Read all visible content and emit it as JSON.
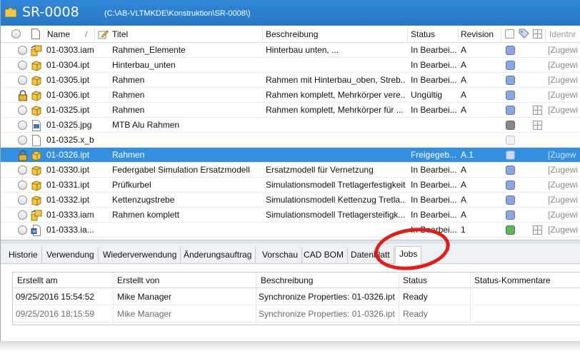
{
  "window": {
    "title": "SR-0008",
    "path": "(C:\\AB-VLTMKDE\\Konstruktion\\SR-0008\\)"
  },
  "columns": {
    "name": "Name",
    "titel": "Titel",
    "beschreibung": "Beschreibung",
    "status": "Status",
    "revision": "Revision",
    "extra": "Identnr"
  },
  "rows": [
    {
      "name": "01-0303.iam",
      "titel": "Rahmen_Elemente",
      "beschreibung": "Hinterbau unten, ...",
      "status": "In Bearbei...",
      "revision": "A",
      "extra": "[Zugewi",
      "icon": "assembly-icon",
      "state": "blue",
      "bom": false,
      "locked": false,
      "selected": false
    },
    {
      "name": "01-0304.ipt",
      "titel": "Hinterbau_unten",
      "beschreibung": "",
      "status": "In Bearbei...",
      "revision": "A",
      "extra": "[Zugewi",
      "icon": "part-icon",
      "state": "blue",
      "bom": false,
      "locked": false,
      "selected": false
    },
    {
      "name": "01-0305.ipt",
      "titel": "Rahmen",
      "beschreibung": "Rahmen mit Hinterbau_oben, Streb...",
      "status": "In Bearbei...",
      "revision": "A",
      "extra": "[Zugewi",
      "icon": "part-icon",
      "state": "blue",
      "bom": false,
      "locked": false,
      "selected": false
    },
    {
      "name": "01-0306.ipt",
      "titel": "Rahmen",
      "beschreibung": "Rahmen komplett, Mehrkörper vere...",
      "status": "Ungültig",
      "revision": "A",
      "extra": "[Zugewi",
      "icon": "part-icon",
      "state": "blue",
      "bom": false,
      "locked": true,
      "selected": false
    },
    {
      "name": "01-0325.ipt",
      "titel": "Rahmen",
      "beschreibung": "Rahmen komplett, Mehrkörper für ...",
      "status": "In Bearbei...",
      "revision": "A",
      "extra": "[Zugewi",
      "icon": "part-icon",
      "state": "blue",
      "bom": true,
      "locked": false,
      "selected": false
    },
    {
      "name": "01-0325.jpg",
      "titel": "MTB Alu Rahmen",
      "beschreibung": "",
      "status": "",
      "revision": "",
      "extra": "",
      "icon": "image-icon",
      "state": "gray",
      "bom": true,
      "locked": false,
      "selected": false
    },
    {
      "name": "01-0325.x_b",
      "titel": "",
      "beschreibung": "",
      "status": "",
      "revision": "",
      "extra": "",
      "icon": "document-icon",
      "state": "light",
      "bom": false,
      "locked": false,
      "selected": false
    },
    {
      "name": "01-0326.ipt",
      "titel": "Rahmen",
      "beschreibung": "",
      "status": "Freigegeb...",
      "revision": "A.1",
      "extra": "[Zugew",
      "icon": "part-icon",
      "state": "selected",
      "bom": false,
      "locked": true,
      "selected": true
    },
    {
      "name": "01-0330.ipt",
      "titel": "Federgabel Simulation Ersatzmodell",
      "beschreibung": "Ersatzmodell für Vernetzung",
      "status": "In Bearbei...",
      "revision": "A",
      "extra": "[Zugewi",
      "icon": "part-icon",
      "state": "blue",
      "bom": false,
      "locked": false,
      "selected": false
    },
    {
      "name": "01-0331.ipt",
      "titel": "Prüfkurbel",
      "beschreibung": "Simulationsmodell Tretlagerfestigkeit",
      "status": "In Bearbei...",
      "revision": "A",
      "extra": "[Zugewi",
      "icon": "part-icon",
      "state": "blue",
      "bom": false,
      "locked": false,
      "selected": false
    },
    {
      "name": "01-0332.ipt",
      "titel": "Kettenzugstrebe",
      "beschreibung": "Simulationsmodell Kettenzug Tretla...",
      "status": "In Bearbei...",
      "revision": "A",
      "extra": "[Zugewi",
      "icon": "part-icon",
      "state": "blue",
      "bom": false,
      "locked": false,
      "selected": false
    },
    {
      "name": "01-0333.iam",
      "titel": "Rahmen komplett",
      "beschreibung": "Simulationsmodell Tretlagersteifigk...",
      "status": "In Bearbei...",
      "revision": "A",
      "extra": "[Zugewi",
      "icon": "assembly-icon",
      "state": "blue",
      "bom": false,
      "locked": false,
      "selected": false
    },
    {
      "name": "01-0333.ia...",
      "titel": "",
      "beschreibung": "",
      "status": "In Bearbei...",
      "revision": "1",
      "extra": "[Zugewi",
      "icon": "word-doc-icon",
      "state": "green",
      "bom": true,
      "locked": false,
      "selected": false
    }
  ],
  "tabs": [
    {
      "label": "Historie"
    },
    {
      "label": "Verwendung"
    },
    {
      "label": "Wiederverwendung"
    },
    {
      "label": "Änderungsauftrag"
    },
    {
      "label": "Vorschau"
    },
    {
      "label": "CAD BOM"
    },
    {
      "label": "Datenblatt"
    },
    {
      "label": "Jobs"
    }
  ],
  "active_tab": "Jobs",
  "jobs": {
    "columns": {
      "created_at": "Erstellt am",
      "created_by": "Erstellt von",
      "description": "Beschreibung",
      "status": "Status",
      "comment": "Status-Kommentare"
    },
    "rows": [
      {
        "created_at": "09/25/2016 15:54:52",
        "created_by": "Mike Manager",
        "description": "Synchronize Properties: 01-0326.ipt",
        "status": "Ready"
      },
      {
        "created_at": "09/25/2016 18:15:59",
        "created_by": "Mike Manager",
        "description": "Synchronize Properties: 01-0326.ipt",
        "status": "Ready"
      }
    ]
  },
  "colors": {
    "titlebar": "#2a7fd0",
    "selected_row": "#3390e0",
    "highlight_ring": "#e21b1b",
    "state_blue": "#8aa6dc",
    "state_green": "#5cb85c",
    "state_gray": "#8a8a8a"
  }
}
